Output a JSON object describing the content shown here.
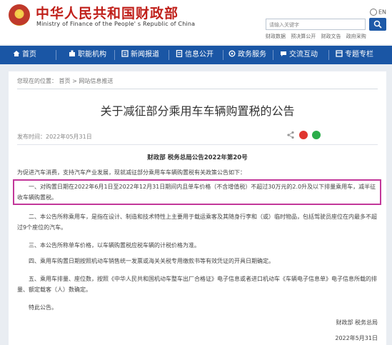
{
  "header": {
    "site_title": "中华人民共和国财政部",
    "site_subtitle": "Ministry of Finance of the People' s Republic of China",
    "lang_label": "EN",
    "search_placeholder": "请输入关键字",
    "quick_links": [
      "财政数据",
      "预决算公开",
      "财政文告",
      "政府采购"
    ]
  },
  "nav": {
    "items": [
      {
        "label": "首页",
        "icon": "home-icon"
      },
      {
        "label": "职能机构",
        "icon": "org-icon"
      },
      {
        "label": "新闻报道",
        "icon": "news-icon"
      },
      {
        "label": "信息公开",
        "icon": "info-icon"
      },
      {
        "label": "政务服务",
        "icon": "service-icon"
      },
      {
        "label": "交流互动",
        "icon": "chat-icon"
      },
      {
        "label": "专题专栏",
        "icon": "topic-icon"
      }
    ]
  },
  "breadcrumb": "您现在的位置： 首页 > 网站信息推送",
  "article": {
    "title": "关于减征部分乘用车车辆购置税的公告",
    "publish_time": "发布时间：2022年05月31日",
    "doc_no": "财政部  税务总局公告2022年第20号",
    "intro": "为促进汽车消费，支持汽车产业发展，现就减征部分乘用车车辆购置税有关政策公告如下：",
    "p1": "一、对购置日期在2022年6月1日至2022年12月31日期间内且单车价格（不含增值税）不超过30万元的2.0升及以下排量乘用车，减半征收车辆购置税。",
    "p2": "二、本公告所称乘用车，是指在设计、制造和技术特性上主要用于载运乘客及其随身行李和（或）临时物品，包括驾驶员座位在内最多不超过9个座位的汽车。",
    "p3": "三、本公告所称单车价格，以车辆购置税应税车辆的计税价格为准。",
    "p4": "四、乘用车购置日期按照机动车销售统一发票或海关关税专用缴款书等有效凭证的开具日期确定。",
    "p5": "五、乘用车排量、座位数，按照《中华人民共和国机动车整车出厂合格证》电子信息或者进口机动车《车辆电子信息单》电子信息所载的排量、额定载客（人）数确定。",
    "p6": "特此公告。",
    "signer": "财政部  税务总局",
    "sign_date": "2022年5月31日"
  },
  "colors": {
    "brand_red": "#c0201a",
    "nav_blue": "#1a56a5",
    "highlight": "#c2379a"
  }
}
